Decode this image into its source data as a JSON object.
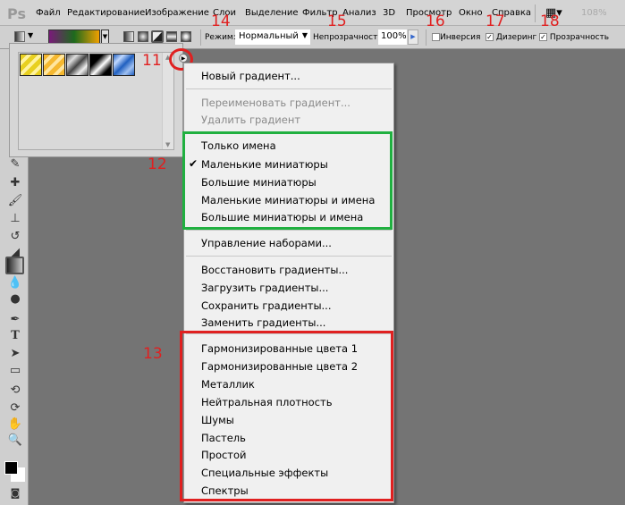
{
  "app": {
    "logo": "Ps"
  },
  "menubar": {
    "items": [
      "Файл",
      "Редактирование",
      "Изображение",
      "Слои",
      "Выделение",
      "Фильтр",
      "Анализ",
      "3D",
      "Просмотр",
      "Окно",
      "Справка"
    ],
    "zoom": "108%"
  },
  "options": {
    "mode_label": "Режим:",
    "mode_value": "Нормальный",
    "opacity_label": "Непрозрачность:",
    "opacity_value": "100%",
    "reverse_label": "Инверсия",
    "reverse_checked": false,
    "dither_label": "Дизеринг",
    "dither_checked": true,
    "transparency_label": "Прозрачность",
    "transparency_checked": true,
    "gradient_colors": [
      "#7a1a7a",
      "#1d6a1d",
      "#f0a000"
    ]
  },
  "picker": {
    "swatches": [
      {
        "name": "yellow"
      },
      {
        "name": "orange"
      },
      {
        "name": "silver"
      },
      {
        "name": "black-white"
      },
      {
        "name": "blue"
      }
    ]
  },
  "menu": {
    "new": "Новый градиент...",
    "rename": "Переименовать градиент...",
    "delete": "Удалить градиент",
    "views": [
      "Только имена",
      "Маленькие миниатюры",
      "Большие миниатюры",
      "Маленькие миниатюры и имена",
      "Большие миниатюры и имена"
    ],
    "checked_view": "Маленькие миниатюры",
    "preset_manager": "Управление наборами...",
    "actions": [
      "Восстановить градиенты...",
      "Загрузить градиенты...",
      "Сохранить градиенты...",
      "Заменить градиенты..."
    ],
    "libraries": [
      "Гармонизированные цвета 1",
      "Гармонизированные цвета 2",
      "Металлик",
      "Нейтральная плотность",
      "Шумы",
      "Пастель",
      "Простой",
      "Специальные эффекты",
      "Спектры"
    ]
  },
  "annotations": {
    "n11": "11",
    "n12": "12",
    "n13": "13",
    "n14": "14",
    "n15": "15",
    "n16": "16",
    "n17": "17",
    "n18": "18",
    "color": "#e02020"
  }
}
